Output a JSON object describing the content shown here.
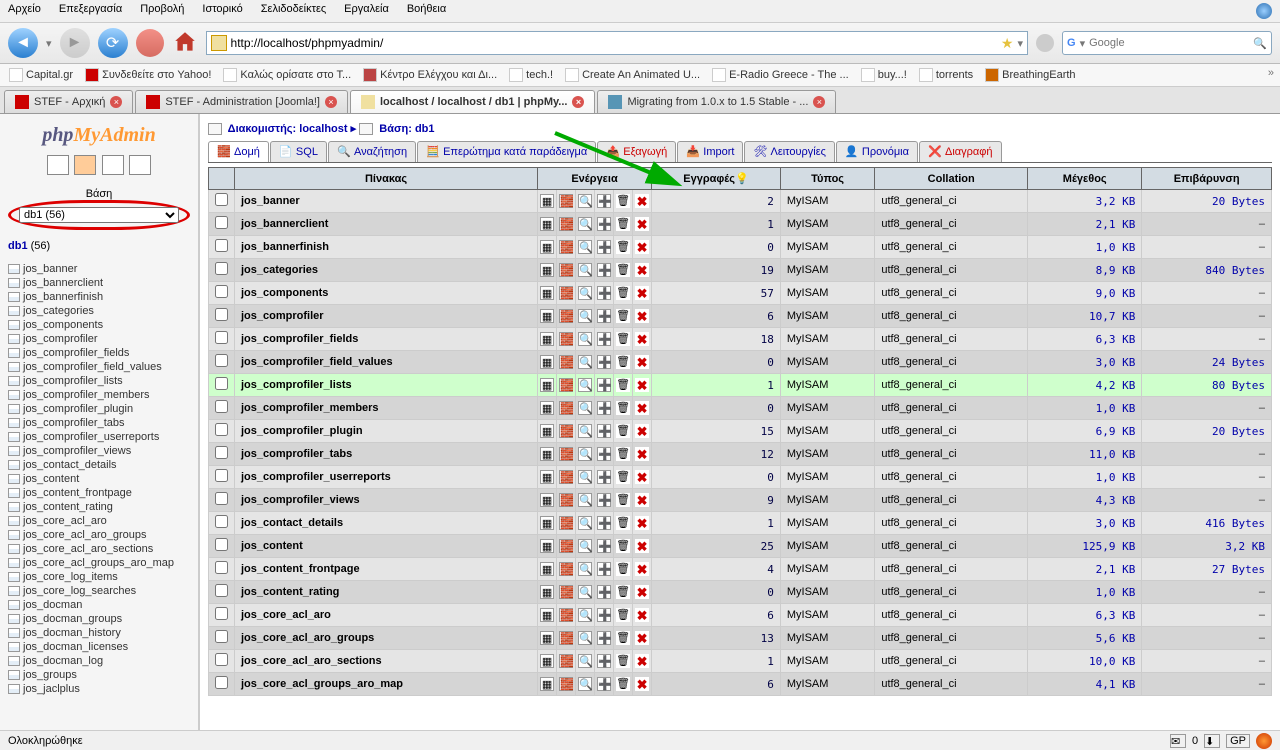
{
  "browser": {
    "menu": [
      "Αρχείο",
      "Επεξεργασία",
      "Προβολή",
      "Ιστορικό",
      "Σελιδοδείκτες",
      "Εργαλεία",
      "Βοήθεια"
    ],
    "url": "http://localhost/phpmyadmin/",
    "search_placeholder": "Google",
    "bookmarks": [
      "Capital.gr",
      "Συνδεθείτε στο Yahoo!",
      "Καλώς ορίσατε στο Τ...",
      "Κέντρο Ελέγχου και Δι...",
      "tech.!",
      "Create An Animated U...",
      "E-Radio Greece - The ...",
      "buy...!",
      "torrents",
      "BreathingEarth"
    ],
    "tabs": [
      {
        "label": "STEF - Αρχική",
        "active": false
      },
      {
        "label": "STEF - Administration [Joomla!]",
        "active": false
      },
      {
        "label": "localhost / localhost / db1 | phpMy...",
        "active": true
      },
      {
        "label": "Migrating from 1.0.x to 1.5 Stable - ...",
        "active": false
      }
    ],
    "status": "Ολοκληρώθηκε",
    "mail_count": "0",
    "gp": "GP"
  },
  "sidebar": {
    "logo_php": "php",
    "logo_my": "My",
    "logo_admin": "Admin",
    "db_label": "Βάση",
    "db_selected": "db1 (56)",
    "db_link": "db1",
    "db_count": "(56)",
    "tables": [
      "jos_banner",
      "jos_bannerclient",
      "jos_bannerfinish",
      "jos_categories",
      "jos_components",
      "jos_comprofiler",
      "jos_comprofiler_fields",
      "jos_comprofiler_field_values",
      "jos_comprofiler_lists",
      "jos_comprofiler_members",
      "jos_comprofiler_plugin",
      "jos_comprofiler_tabs",
      "jos_comprofiler_userreports",
      "jos_comprofiler_views",
      "jos_contact_details",
      "jos_content",
      "jos_content_frontpage",
      "jos_content_rating",
      "jos_core_acl_aro",
      "jos_core_acl_aro_groups",
      "jos_core_acl_aro_sections",
      "jos_core_acl_groups_aro_map",
      "jos_core_log_items",
      "jos_core_log_searches",
      "jos_docman",
      "jos_docman_groups",
      "jos_docman_history",
      "jos_docman_licenses",
      "jos_docman_log",
      "jos_groups",
      "jos_jaclplus"
    ]
  },
  "main": {
    "bc_server_lbl": "Διακομιστής:",
    "bc_server": "localhost",
    "bc_db_lbl": "Βάση:",
    "bc_db": "db1",
    "tabs": {
      "structure": "Δομή",
      "sql": "SQL",
      "search": "Αναζήτηση",
      "query": "Επερώτημα κατά παράδειγμα",
      "export": "Εξαγωγή",
      "import": "Import",
      "operations": "Λειτουργίες",
      "privileges": "Προνόμια",
      "drop": "Διαγραφή"
    },
    "headers": {
      "table": "Πίνακας",
      "action": "Ενέργεια",
      "records": "Εγγραφές",
      "type": "Τύπος",
      "collation": "Collation",
      "size": "Μέγεθος",
      "overhead": "Επιβάρυνση"
    },
    "rows": [
      {
        "name": "jos_banner",
        "rec": "2",
        "type": "MyISAM",
        "coll": "utf8_general_ci",
        "size": "3,2 KB",
        "ov": "20 Bytes"
      },
      {
        "name": "jos_bannerclient",
        "rec": "1",
        "type": "MyISAM",
        "coll": "utf8_general_ci",
        "size": "2,1 KB",
        "ov": "-"
      },
      {
        "name": "jos_bannerfinish",
        "rec": "0",
        "type": "MyISAM",
        "coll": "utf8_general_ci",
        "size": "1,0 KB",
        "ov": "-"
      },
      {
        "name": "jos_categories",
        "rec": "19",
        "type": "MyISAM",
        "coll": "utf8_general_ci",
        "size": "8,9 KB",
        "ov": "840 Bytes"
      },
      {
        "name": "jos_components",
        "rec": "57",
        "type": "MyISAM",
        "coll": "utf8_general_ci",
        "size": "9,0 KB",
        "ov": "-"
      },
      {
        "name": "jos_comprofiler",
        "rec": "6",
        "type": "MyISAM",
        "coll": "utf8_general_ci",
        "size": "10,7 KB",
        "ov": "-"
      },
      {
        "name": "jos_comprofiler_fields",
        "rec": "18",
        "type": "MyISAM",
        "coll": "utf8_general_ci",
        "size": "6,3 KB",
        "ov": "-"
      },
      {
        "name": "jos_comprofiler_field_values",
        "rec": "0",
        "type": "MyISAM",
        "coll": "utf8_general_ci",
        "size": "3,0 KB",
        "ov": "24 Bytes"
      },
      {
        "name": "jos_comprofiler_lists",
        "rec": "1",
        "type": "MyISAM",
        "coll": "utf8_general_ci",
        "size": "4,2 KB",
        "ov": "80 Bytes",
        "hl": true
      },
      {
        "name": "jos_comprofiler_members",
        "rec": "0",
        "type": "MyISAM",
        "coll": "utf8_general_ci",
        "size": "1,0 KB",
        "ov": "-"
      },
      {
        "name": "jos_comprofiler_plugin",
        "rec": "15",
        "type": "MyISAM",
        "coll": "utf8_general_ci",
        "size": "6,9 KB",
        "ov": "20 Bytes"
      },
      {
        "name": "jos_comprofiler_tabs",
        "rec": "12",
        "type": "MyISAM",
        "coll": "utf8_general_ci",
        "size": "11,0 KB",
        "ov": "-"
      },
      {
        "name": "jos_comprofiler_userreports",
        "rec": "0",
        "type": "MyISAM",
        "coll": "utf8_general_ci",
        "size": "1,0 KB",
        "ov": "-"
      },
      {
        "name": "jos_comprofiler_views",
        "rec": "9",
        "type": "MyISAM",
        "coll": "utf8_general_ci",
        "size": "4,3 KB",
        "ov": "-"
      },
      {
        "name": "jos_contact_details",
        "rec": "1",
        "type": "MyISAM",
        "coll": "utf8_general_ci",
        "size": "3,0 KB",
        "ov": "416 Bytes"
      },
      {
        "name": "jos_content",
        "rec": "25",
        "type": "MyISAM",
        "coll": "utf8_general_ci",
        "size": "125,9 KB",
        "ov": "3,2 KB"
      },
      {
        "name": "jos_content_frontpage",
        "rec": "4",
        "type": "MyISAM",
        "coll": "utf8_general_ci",
        "size": "2,1 KB",
        "ov": "27 Bytes"
      },
      {
        "name": "jos_content_rating",
        "rec": "0",
        "type": "MyISAM",
        "coll": "utf8_general_ci",
        "size": "1,0 KB",
        "ov": "-"
      },
      {
        "name": "jos_core_acl_aro",
        "rec": "6",
        "type": "MyISAM",
        "coll": "utf8_general_ci",
        "size": "6,3 KB",
        "ov": "-"
      },
      {
        "name": "jos_core_acl_aro_groups",
        "rec": "13",
        "type": "MyISAM",
        "coll": "utf8_general_ci",
        "size": "5,6 KB",
        "ov": "-"
      },
      {
        "name": "jos_core_acl_aro_sections",
        "rec": "1",
        "type": "MyISAM",
        "coll": "utf8_general_ci",
        "size": "10,0 KB",
        "ov": "-"
      },
      {
        "name": "jos_core_acl_groups_aro_map",
        "rec": "6",
        "type": "MyISAM",
        "coll": "utf8_general_ci",
        "size": "4,1 KB",
        "ov": "-"
      }
    ]
  }
}
